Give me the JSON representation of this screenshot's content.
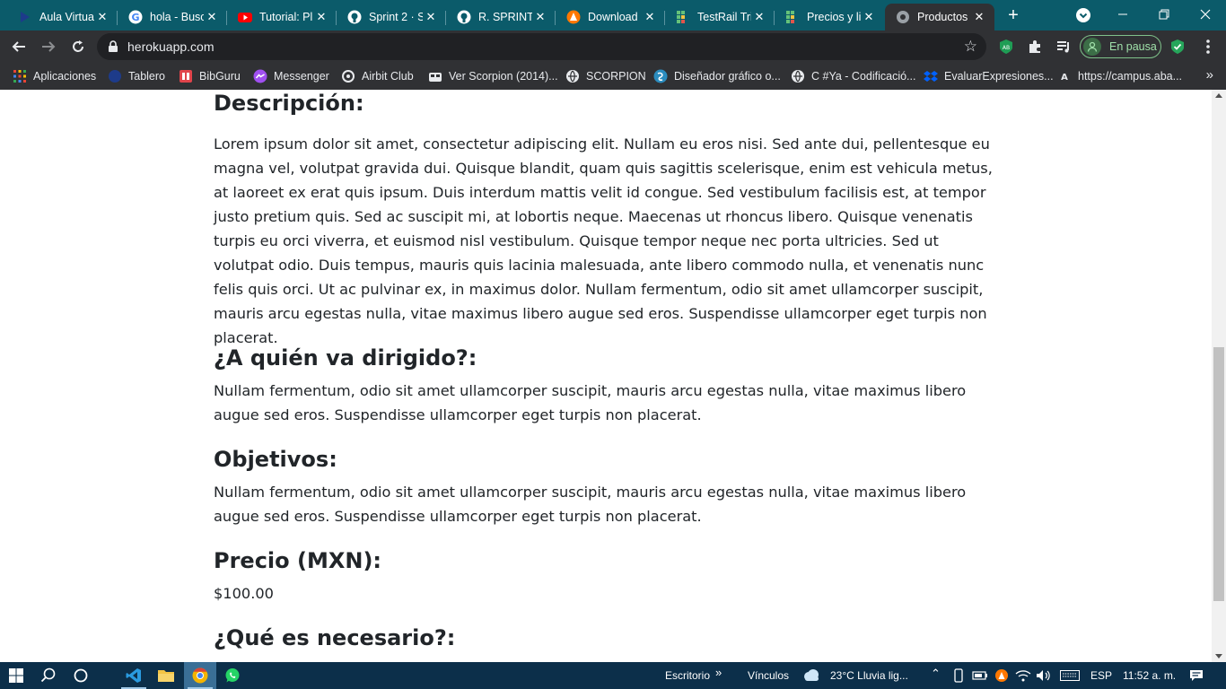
{
  "browser": {
    "tabs": [
      {
        "title": "Aula Virtual",
        "icon": "aula-virtual-icon",
        "active": false
      },
      {
        "title": "hola - Buscar",
        "icon": "google-icon",
        "active": false
      },
      {
        "title": "Tutorial: Pl",
        "icon": "youtube-icon",
        "active": false
      },
      {
        "title": "Sprint 2 · S",
        "icon": "github-icon",
        "active": false
      },
      {
        "title": "R. SPRINT",
        "icon": "github-icon",
        "active": false
      },
      {
        "title": "Download",
        "icon": "avast-icon",
        "active": false
      },
      {
        "title": "TestRail Tri",
        "icon": "testrail-icon",
        "active": false
      },
      {
        "title": "Precios y li",
        "icon": "testrail-icon",
        "active": false
      },
      {
        "title": "Productos",
        "icon": "globe-icon",
        "active": true
      }
    ],
    "url": "herokuapp.com",
    "profile_label": "En pausa",
    "bookmarks": [
      {
        "label": "Aplicaciones",
        "icon": "apps-grid-icon"
      },
      {
        "label": "Tablero",
        "icon": "tablero-icon"
      },
      {
        "label": "BibGuru",
        "icon": "bibguru-icon"
      },
      {
        "label": "Messenger",
        "icon": "messenger-icon"
      },
      {
        "label": "Airbit Club",
        "icon": "airbit-icon"
      },
      {
        "label": "Ver Scorpion (2014)...",
        "icon": "scorpion-tv-icon"
      },
      {
        "label": "SCORPION",
        "icon": "globe-icon"
      },
      {
        "label": "Diseñador gráfico o...",
        "icon": "designer-icon"
      },
      {
        "label": "C #Ya - Codificació...",
        "icon": "globe-icon"
      },
      {
        "label": "EvaluarExpresiones...",
        "icon": "dropbox-icon"
      },
      {
        "label": "https://campus.aba...",
        "icon": "campus-icon"
      }
    ]
  },
  "page": {
    "descripcion_title": "Descripción:",
    "descripcion_text": "Lorem ipsum dolor sit amet, consectetur adipiscing elit. Nullam eu eros nisi. Sed ante dui, pellentesque eu magna vel, volutpat gravida dui. Quisque blandit, quam quis sagittis scelerisque, enim est vehicula metus, at laoreet ex erat quis ipsum. Duis interdum mattis velit id congue. Sed vestibulum facilisis est, at tempor justo pretium quis. Sed ac suscipit mi, at lobortis neque. Maecenas ut rhoncus libero. Quisque venenatis turpis eu orci viverra, et euismod nisl vestibulum. Quisque tempor neque nec porta ultricies. Sed ut volutpat odio. Duis tempus, mauris quis lacinia malesuada, ante libero commodo nulla, et venenatis nunc felis quis orci. Ut ac pulvinar ex, in maximus dolor. Nullam fermentum, odio sit amet ullamcorper suscipit, mauris arcu egestas nulla, vitae maximus libero augue sed eros. Suspendisse ullamcorper eget turpis non placerat.",
    "dirigido_title": "¿A quién va dirigido?:",
    "dirigido_text": "Nullam fermentum, odio sit amet ullamcorper suscipit, mauris arcu egestas nulla, vitae maximus libero augue sed eros. Suspendisse ullamcorper eget turpis non placerat.",
    "objetivos_title": "Objetivos:",
    "objetivos_text": "Nullam fermentum, odio sit amet ullamcorper suscipit, mauris arcu egestas nulla, vitae maximus libero augue sed eros. Suspendisse ullamcorper eget turpis non placerat.",
    "precio_title": "Precio (MXN):",
    "precio_value": "$100.00",
    "necesario_title": "¿Qué es necesario?:"
  },
  "taskbar": {
    "escritorio": "Escritorio",
    "vinculos": "Vínculos",
    "weather": "23°C  Lluvia lig...",
    "lang": "ESP",
    "time": "11:52 a. m."
  },
  "colors": {
    "tabstrip": "#0b5b6a",
    "toolbar": "#303134",
    "taskbar": "#0c2f4a",
    "text": "#212529"
  }
}
